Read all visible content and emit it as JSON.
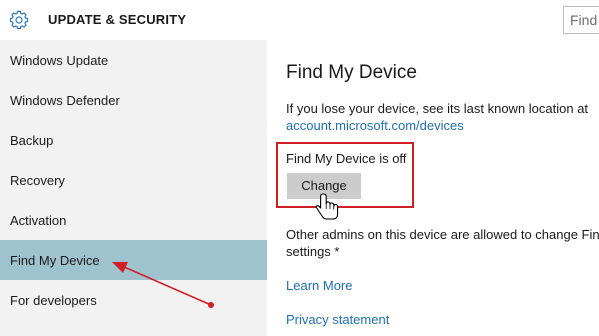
{
  "header": {
    "title": "UPDATE & SECURITY",
    "icon": "gear-icon",
    "search_text": "Find"
  },
  "sidebar": {
    "items": [
      {
        "label": "Windows Update",
        "selected": false
      },
      {
        "label": "Windows Defender",
        "selected": false
      },
      {
        "label": "Backup",
        "selected": false
      },
      {
        "label": "Recovery",
        "selected": false
      },
      {
        "label": "Activation",
        "selected": false
      },
      {
        "label": "Find My Device",
        "selected": true
      },
      {
        "label": "For developers",
        "selected": false
      }
    ]
  },
  "main": {
    "title": "Find My Device",
    "description": "If you lose your device, see its last known location at",
    "location_link": "account.microsoft.com/devices",
    "status": "Find My Device is off",
    "change_button": "Change",
    "admin_note_line1": "Other admins on this device are allowed to change Find M",
    "admin_note_line2": "settings *",
    "learn_more": "Learn More",
    "privacy_statement": "Privacy statement"
  },
  "colors": {
    "accent_link": "#1f6fb8",
    "selected_item": "#9ec3cf",
    "sidebar_bg": "#f2f2f2",
    "annotation_red": "#d21f26",
    "button_bg": "#cccccc"
  },
  "annotations": {
    "highlight_box": "red-outline",
    "arrow": "red-arrow",
    "cursor": "hand-pointer-icon"
  }
}
